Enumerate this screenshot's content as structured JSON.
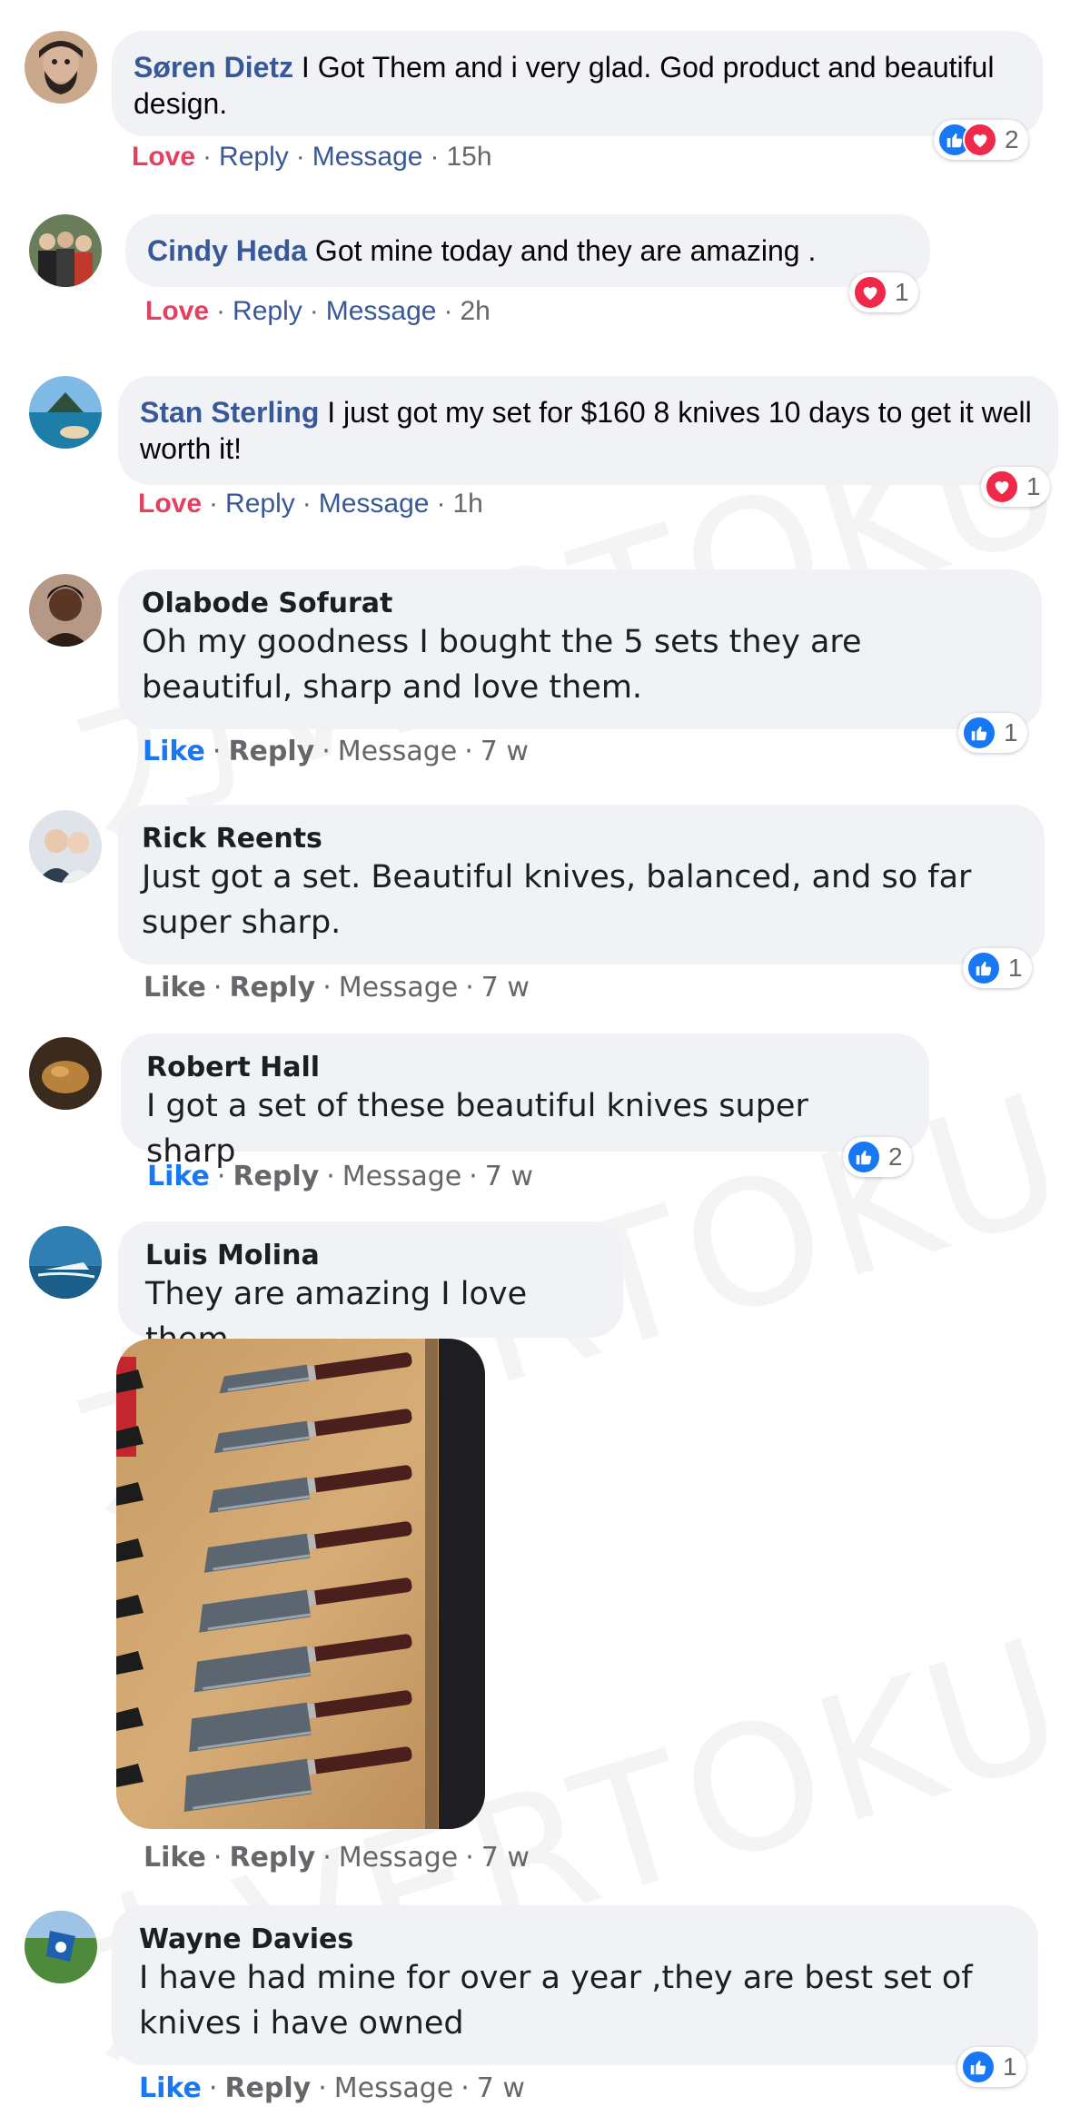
{
  "watermark": {
    "text": "力VERTOKU"
  },
  "comments": [
    {
      "name": "Søren Dietz",
      "text": "I Got Them and i very glad. God product and beautiful design.",
      "actions": [
        "Love",
        "Reply",
        "Message",
        "15h"
      ],
      "reaction_count": "2",
      "reactions": [
        "like",
        "love"
      ]
    },
    {
      "name": "Cindy Heda",
      "text": "Got mine today and they are amazing .",
      "actions": [
        "Love",
        "Reply",
        "Message",
        "2h"
      ],
      "reaction_count": "1",
      "reactions": [
        "love"
      ]
    },
    {
      "name": "Stan Sterling",
      "text": "I just got my set for $160 8 knives 10 days to get it well worth it!",
      "actions": [
        "Love",
        "Reply",
        "Message",
        "1h"
      ],
      "reaction_count": "1",
      "reactions": [
        "love"
      ]
    },
    {
      "name": "Olabode Sofurat",
      "text": "Oh my goodness I bought the 5 sets they are beautiful, sharp and love them.",
      "actions": [
        "Like",
        "Reply",
        "Message",
        "7 w"
      ],
      "reaction_count": "1",
      "reactions": [
        "like"
      ]
    },
    {
      "name": "Rick Reents",
      "text": "Just got a set. Beautiful knives, balanced, and so far super sharp.",
      "actions": [
        "Like",
        "Reply",
        "Message",
        "7 w"
      ],
      "reaction_count": "1",
      "reactions": [
        "like"
      ]
    },
    {
      "name": "Robert Hall",
      "text": "I got a set of these beautiful knives super sharp",
      "actions": [
        "Like",
        "Reply",
        "Message",
        "7 w"
      ],
      "reaction_count": "2",
      "reactions": [
        "like"
      ]
    },
    {
      "name": "Luis Molina",
      "text": "They are amazing I love them",
      "actions": [
        "Like",
        "Reply",
        "Message",
        "7 w"
      ],
      "photo": "knife-set-photo",
      "knife_count": 8
    },
    {
      "name": "Wayne Davies",
      "text": "I have had mine for over a year ,they are best set of knives i have owned",
      "actions": [
        "Like",
        "Reply",
        "Message",
        "7 w"
      ],
      "reaction_count": "1",
      "reactions": [
        "like"
      ]
    }
  ],
  "colors": {
    "bubble": "#f0f2f5",
    "name_link": "#385898",
    "love": "#e4405f",
    "like": "#1877f2",
    "meta": "#65676b"
  }
}
